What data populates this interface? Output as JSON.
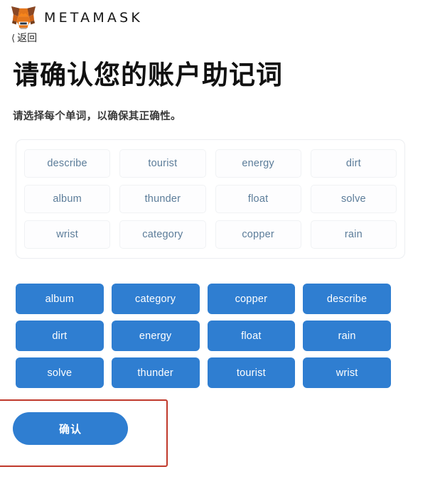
{
  "header": {
    "brand": "METAMASK",
    "logo_icon": "metamask-fox-icon",
    "back_label": "返回",
    "back_icon": "chevron-left-icon"
  },
  "page": {
    "title": "请确认您的账户助记词",
    "subtitle": "请选择每个单词，以确保其正确性。"
  },
  "selected_words": [
    "describe",
    "tourist",
    "energy",
    "dirt",
    "album",
    "thunder",
    "float",
    "solve",
    "wrist",
    "category",
    "copper",
    "rain"
  ],
  "word_bank": [
    "album",
    "category",
    "copper",
    "describe",
    "dirt",
    "energy",
    "float",
    "rain",
    "solve",
    "thunder",
    "tourist",
    "wrist"
  ],
  "confirm": {
    "label": "确认"
  },
  "colors": {
    "accent_blue": "#2f7ed1",
    "chip_text": "#5b7c99",
    "annotation_red": "#c0392b",
    "fox_orange": "#e4761b",
    "fox_brown": "#763e1a"
  }
}
